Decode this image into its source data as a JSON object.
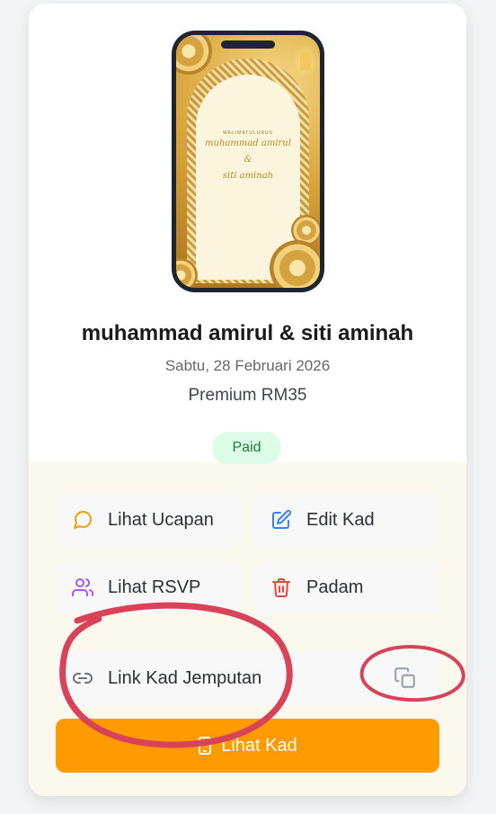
{
  "invitation": {
    "preview": {
      "header_text": "WALIMATULURUS",
      "groom": "muhammad amirul",
      "ampersand": "&",
      "bride": "siti aminah"
    },
    "title": "muhammad amirul & siti aminah",
    "date": "Sabtu, 28 Februari 2026",
    "package": "Premium RM35",
    "status": "Paid"
  },
  "actions": {
    "view_wishes": "Lihat Ucapan",
    "edit_card": "Edit Kad",
    "view_rsvp": "Lihat RSVP",
    "delete": "Padam",
    "invite_link": "Link Kad Jemputan",
    "view_card": "Lihat Kad"
  },
  "colors": {
    "accent": "#ff9a00",
    "paid_bg": "#dcfce7",
    "paid_text": "#1f7a3d",
    "annotation": "#d9435a"
  },
  "icons": {
    "view_wishes": "message-circle-icon",
    "edit_card": "edit-icon",
    "view_rsvp": "users-icon",
    "delete": "trash-icon",
    "invite_link": "link-icon",
    "copy": "copy-icon",
    "view_card": "phone-icon"
  }
}
